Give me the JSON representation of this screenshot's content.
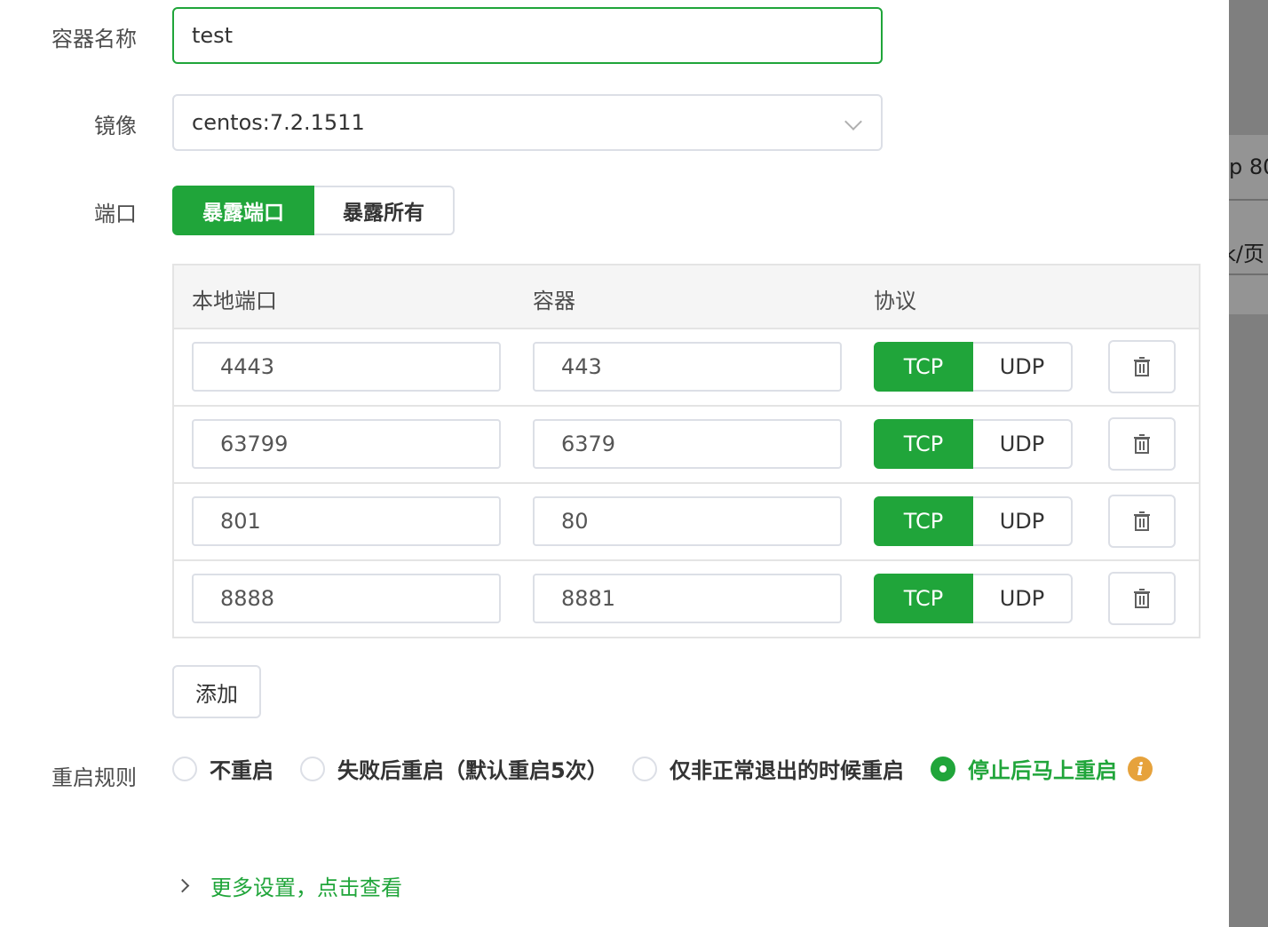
{
  "form": {
    "name_label": "容器名称",
    "name_value": "test",
    "image_label": "镜像",
    "image_value": "centos:7.2.1511",
    "port_label": "端口",
    "port_mode": {
      "options": [
        "暴露端口",
        "暴露所有"
      ],
      "selected": "暴露端口"
    },
    "port_table": {
      "headers": [
        "本地端口",
        "容器",
        "协议"
      ],
      "rows": [
        {
          "local": "4443",
          "container": "443",
          "protocol": "TCP"
        },
        {
          "local": "63799",
          "container": "6379",
          "protocol": "TCP"
        },
        {
          "local": "801",
          "container": "80",
          "protocol": "TCP"
        },
        {
          "local": "8888",
          "container": "8881",
          "protocol": "TCP"
        }
      ],
      "protocol_options": [
        "TCP",
        "UDP"
      ],
      "delete_icon": "trash-icon"
    },
    "add_button": "添加",
    "restart_label": "重启规则",
    "restart_options": [
      {
        "label": "不重启",
        "checked": false
      },
      {
        "label": "失败后重启（默认重启5次）",
        "checked": false
      },
      {
        "label": "仅非正常退出的时候重启",
        "checked": false
      },
      {
        "label": "停止后马上重启",
        "checked": true
      }
    ],
    "info_icon": "info-icon",
    "more_settings": "更多设置，点击查看"
  },
  "background_peek": {
    "text_1": "p 80",
    "text_2": "k/页"
  },
  "colors": {
    "accent": "#20a53a",
    "border": "#dcdfe6",
    "table_header_bg": "#f5f5f5",
    "info": "#e6a23c",
    "mask": "#7f7f7f"
  }
}
